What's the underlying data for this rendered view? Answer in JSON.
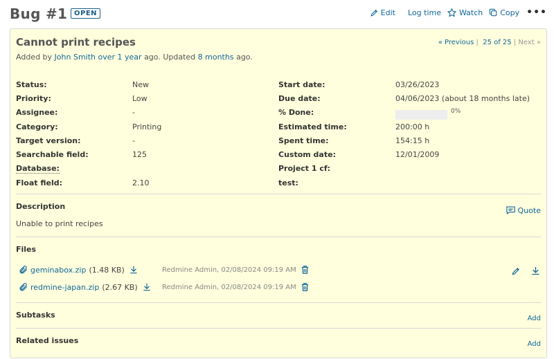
{
  "header": {
    "title": "Bug #1",
    "status_badge": "OPEN",
    "actions": {
      "edit": "Edit",
      "log_time": "Log time",
      "watch": "Watch",
      "copy": "Copy",
      "more": "•••"
    }
  },
  "issue": {
    "subject": "Cannot print recipes",
    "nav": {
      "previous": "« Previous",
      "sep1": "|",
      "position": "25 of 25",
      "sep2": "|",
      "next": "Next »"
    },
    "author_line": {
      "prefix": "Added by",
      "author": "John Smith",
      "created": "over 1 year",
      "middle": "ago. Updated",
      "updated": "8 months",
      "suffix": "ago."
    },
    "left_attributes": [
      {
        "label": "Status:",
        "value": "New"
      },
      {
        "label": "Priority:",
        "value": "Low"
      },
      {
        "label": "Assignee:",
        "value": "-"
      },
      {
        "label": "Category:",
        "value": "Printing"
      },
      {
        "label": "Target version:",
        "value": "-"
      },
      {
        "label": "Searchable field:",
        "value": "125"
      },
      {
        "label": "Database:",
        "value": ""
      },
      {
        "label": "Float field:",
        "value": "2.10"
      }
    ],
    "right_attributes": {
      "start_date": {
        "label": "Start date:",
        "value": "03/26/2023"
      },
      "due_date": {
        "label": "Due date:",
        "value": "04/06/2023 (about 18 months late)"
      },
      "done": {
        "label": "% Done:",
        "value": "0%",
        "progress": 0
      },
      "estimated": {
        "label": "Estimated time:",
        "value": "200:00 h"
      },
      "spent": {
        "label": "Spent time:",
        "value": "154:15 h"
      },
      "custom_date": {
        "label": "Custom date:",
        "value": "12/01/2009"
      },
      "project_cf": {
        "label": "Project 1 cf:",
        "value": ""
      },
      "test": {
        "label": "test:",
        "value": ""
      }
    },
    "description": {
      "title": "Description",
      "quote": "Quote",
      "text": "Unable to print recipes"
    },
    "files": {
      "title": "Files",
      "items": [
        {
          "name": "geminabox.zip",
          "size": "(1.48 KB)",
          "meta": "Redmine Admin, 02/08/2024 09:19 AM"
        },
        {
          "name": "redmine-japan.zip",
          "size": "(2.67 KB)",
          "meta": "Redmine Admin, 02/08/2024 09:19 AM"
        }
      ]
    },
    "subtasks": {
      "title": "Subtasks",
      "add": "Add"
    },
    "related": {
      "title": "Related issues",
      "add": "Add"
    }
  },
  "colors": {
    "link": "#116699",
    "panel_bg": "#ffffdd",
    "overdue": "#c61a1a"
  },
  "icons": [
    "pencil-icon",
    "star-icon",
    "copy-icon",
    "quote-icon",
    "paperclip-icon",
    "download-icon",
    "trash-icon"
  ]
}
